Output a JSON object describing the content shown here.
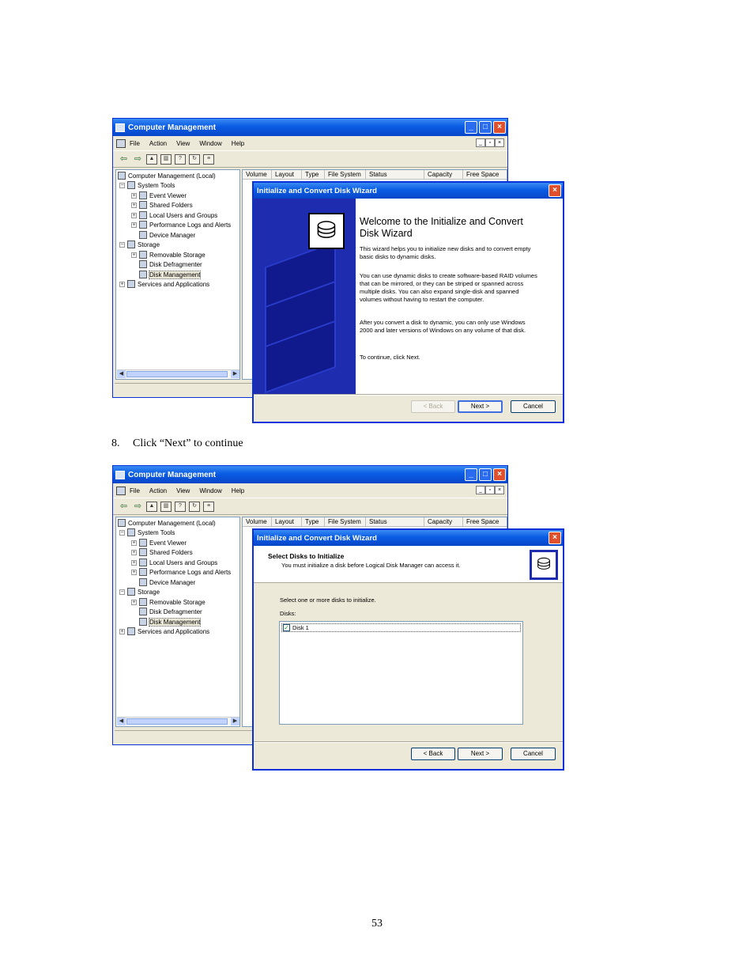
{
  "cm_window": {
    "title": "Computer Management",
    "menu": [
      "File",
      "Action",
      "View",
      "Window",
      "Help"
    ],
    "tree": [
      {
        "label": "Computer Management (Local)",
        "indent": 0,
        "expander": ""
      },
      {
        "label": "System Tools",
        "indent": 1,
        "expander": "−"
      },
      {
        "label": "Event Viewer",
        "indent": 2,
        "expander": "+"
      },
      {
        "label": "Shared Folders",
        "indent": 2,
        "expander": "+"
      },
      {
        "label": "Local Users and Groups",
        "indent": 2,
        "expander": "+"
      },
      {
        "label": "Performance Logs and Alerts",
        "indent": 2,
        "expander": "+"
      },
      {
        "label": "Device Manager",
        "indent": 2,
        "expander": ""
      },
      {
        "label": "Storage",
        "indent": 1,
        "expander": "−"
      },
      {
        "label": "Removable Storage",
        "indent": 2,
        "expander": "+"
      },
      {
        "label": "Disk Defragmenter",
        "indent": 2,
        "expander": ""
      },
      {
        "label": "Disk Management",
        "indent": 2,
        "expander": "",
        "selected": true
      },
      {
        "label": "Services and Applications",
        "indent": 1,
        "expander": "+"
      }
    ],
    "columns": [
      "Volume",
      "Layout",
      "Type",
      "File System",
      "Status",
      "Capacity",
      "Free Space"
    ]
  },
  "wizard1": {
    "title": "Initialize and Convert Disk Wizard",
    "heading": "Welcome to the Initialize and Convert Disk Wizard",
    "p1": "This wizard helps you to initialize new disks and to convert empty basic disks to dynamic disks.",
    "p2": "You can use dynamic disks to create software-based RAID volumes that can be mirrored, or they can be striped or spanned across multiple disks. You can also expand single-disk and spanned volumes without having to restart the computer.",
    "p3": "After you convert a disk to dynamic, you can only use Windows 2000 and later versions of Windows on any volume of that disk.",
    "p4": "To continue, click Next.",
    "back": "< Back",
    "next": "Next >",
    "cancel": "Cancel"
  },
  "caption": {
    "number": "8.",
    "text": "Click “Next” to continue"
  },
  "wizard2": {
    "title": "Initialize and Convert Disk Wizard",
    "header_title": "Select Disks to Initialize",
    "header_sub": "You must initialize a disk before Logical Disk Manager can access it.",
    "instruction": "Select one or more disks to initialize.",
    "disks_label": "Disks:",
    "disks": [
      {
        "label": "Disk 1",
        "checked": true
      }
    ],
    "back": "< Back",
    "next": "Next >",
    "cancel": "Cancel"
  },
  "page_number": "53"
}
